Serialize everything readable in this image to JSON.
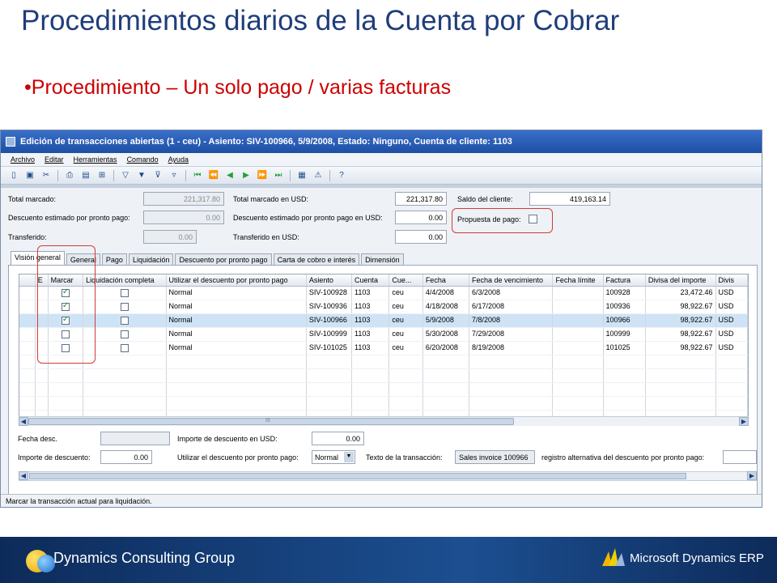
{
  "slide": {
    "title": "Procedimientos diarios de la Cuenta por Cobrar",
    "bullet": "Procedimiento – Un solo pago / varias facturas"
  },
  "window": {
    "title": "Edición de transacciones abiertas (1 - ceu) - Asiento: SIV-100966, 5/9/2008, Estado: Ninguno, Cuenta de cliente: 1103",
    "menu": [
      "Archivo",
      "Editar",
      "Herramientas",
      "Comando",
      "Ayuda"
    ],
    "toolbar_icons": [
      "new-icon",
      "save-icon",
      "cut-icon",
      "print-icon",
      "print-preview-icon",
      "export-icon",
      "filter-icon",
      "filter-by-selection-icon",
      "advanced-filter-icon",
      "remove-filter-icon",
      "first-record-icon",
      "previous-page-icon",
      "previous-record-icon",
      "next-record-icon",
      "next-page-icon",
      "last-record-icon",
      "document-icon",
      "alert-icon",
      "help-icon"
    ],
    "fields": {
      "total_marcado_label": "Total marcado:",
      "total_marcado_value": "221,317.80",
      "total_usd_label": "Total marcado en USD:",
      "total_usd_value": "221,317.80",
      "saldo_label": "Saldo del cliente:",
      "saldo_value": "419,163.14",
      "desc_estimado_label": "Descuento estimado por pronto pago:",
      "desc_estimado_value": "0.00",
      "desc_estimado_usd_label": "Descuento estimado por pronto pago en USD:",
      "desc_estimado_usd_value": "0.00",
      "propuesta_label": "Propuesta de pago:",
      "transferido_label": "Transferido:",
      "transferido_value": "0.00",
      "transferido_usd_label": "Transferido en USD:",
      "transferido_usd_value": "0.00"
    },
    "tabs": [
      "Visión general",
      "General",
      "Pago",
      "Liquidación",
      "Descuento por pronto pago",
      "Carta de cobro e interés",
      "Dimensión"
    ],
    "grid": {
      "headers": [
        "",
        "E",
        "Marcar",
        "Liquidación completa",
        "Utilizar el descuento por pronto pago",
        "Asiento",
        "Cuenta",
        "Cue...",
        "Fecha",
        "Fecha de vencimiento",
        "Fecha límite",
        "Factura",
        "Divisa del importe",
        "Divis"
      ],
      "rows": [
        {
          "marcar": true,
          "liq": false,
          "uso": "Normal",
          "asiento": "SIV-100928",
          "cuenta": "1103",
          "cue": "ceu",
          "fecha": "4/4/2008",
          "venc": "6/3/2008",
          "limite": "",
          "factura": "100928",
          "importe": "23,472.46",
          "divisa": "USD",
          "selected": false
        },
        {
          "marcar": true,
          "liq": false,
          "uso": "Normal",
          "asiento": "SIV-100936",
          "cuenta": "1103",
          "cue": "ceu",
          "fecha": "4/18/2008",
          "venc": "6/17/2008",
          "limite": "",
          "factura": "100936",
          "importe": "98,922.67",
          "divisa": "USD",
          "selected": false
        },
        {
          "marcar": true,
          "liq": false,
          "uso": "Normal",
          "asiento": "SIV-100966",
          "cuenta": "1103",
          "cue": "ceu",
          "fecha": "5/9/2008",
          "venc": "7/8/2008",
          "limite": "",
          "factura": "100966",
          "importe": "98,922.67",
          "divisa": "USD",
          "selected": true
        },
        {
          "marcar": false,
          "liq": false,
          "uso": "Normal",
          "asiento": "SIV-100999",
          "cuenta": "1103",
          "cue": "ceu",
          "fecha": "5/30/2008",
          "venc": "7/29/2008",
          "limite": "",
          "factura": "100999",
          "importe": "98,922.67",
          "divisa": "USD",
          "selected": false
        },
        {
          "marcar": false,
          "liq": false,
          "uso": "Normal",
          "asiento": "SIV-101025",
          "cuenta": "1103",
          "cue": "ceu",
          "fecha": "6/20/2008",
          "venc": "8/19/2008",
          "limite": "",
          "factura": "101025",
          "importe": "98,922.67",
          "divisa": "USD",
          "selected": false
        }
      ],
      "scroll_marker": "III"
    },
    "bottom": {
      "fecha_desc_label": "Fecha desc.",
      "importe_desc_usd_label": "Importe de descuento en USD:",
      "importe_desc_usd_value": "0.00",
      "importe_desc_label": "Importe de descuento:",
      "importe_desc_value": "0.00",
      "utilizar_label": "Utilizar el descuento por pronto pago:",
      "utilizar_value": "Normal",
      "texto_label": "Texto de la transacción:",
      "texto_value": "Sales invoice 100966",
      "registro_label": "registro alternativa del descuento por pronto pago:"
    },
    "status": "Marcar la transacción actual para liquidación."
  },
  "footer": {
    "left": "Dynamics Consulting Group",
    "right": "Microsoft Dynamics ERP"
  }
}
